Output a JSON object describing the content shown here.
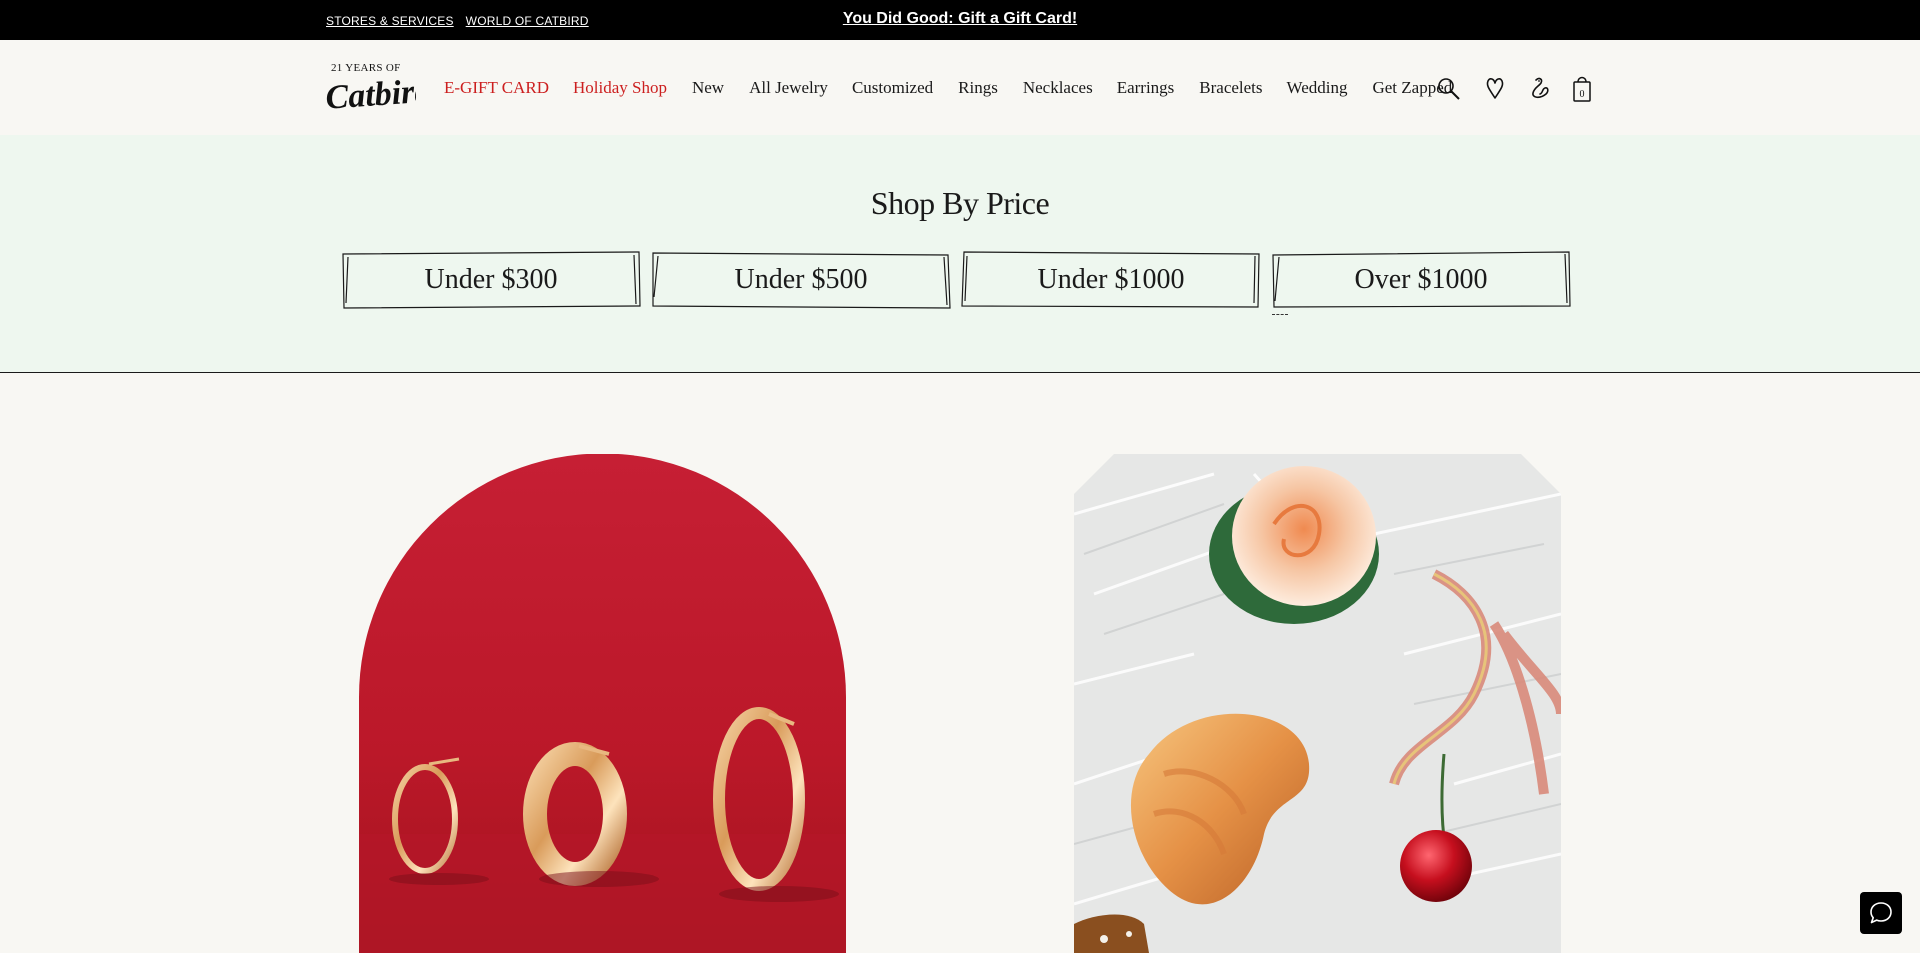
{
  "topbar": {
    "links": [
      "STORES & SERVICES",
      "WORLD OF CATBIRD"
    ],
    "promo": "You Did Good: Gift a Gift Card!"
  },
  "logo": {
    "tagline": "21 YEARS OF",
    "wordmark": "Catbird"
  },
  "nav": {
    "items": [
      {
        "label": "E-GIFT CARD",
        "highlight": true
      },
      {
        "label": "Holiday Shop",
        "highlight": true
      },
      {
        "label": "New",
        "highlight": false
      },
      {
        "label": "All Jewelry",
        "highlight": false
      },
      {
        "label": "Customized",
        "highlight": false
      },
      {
        "label": "Rings",
        "highlight": false
      },
      {
        "label": "Necklaces",
        "highlight": false
      },
      {
        "label": "Earrings",
        "highlight": false
      },
      {
        "label": "Bracelets",
        "highlight": false
      },
      {
        "label": "Wedding",
        "highlight": false
      },
      {
        "label": "Get Zapped",
        "highlight": false
      }
    ],
    "icons": [
      "search-icon",
      "heart-icon",
      "bird-icon",
      "bag-icon"
    ],
    "bag_count": "0"
  },
  "shop_by_price": {
    "title": "Shop By Price",
    "buttons": [
      "Under $300",
      "Under $500",
      "Under $1000",
      "Over $1000"
    ]
  },
  "colors": {
    "accent_red": "#cc1f1f",
    "topbar_bg": "#000000",
    "page_bg": "#f8f7f3",
    "shop_bg": "#eef7ef"
  },
  "chat": {
    "icon": "chat-icon"
  }
}
